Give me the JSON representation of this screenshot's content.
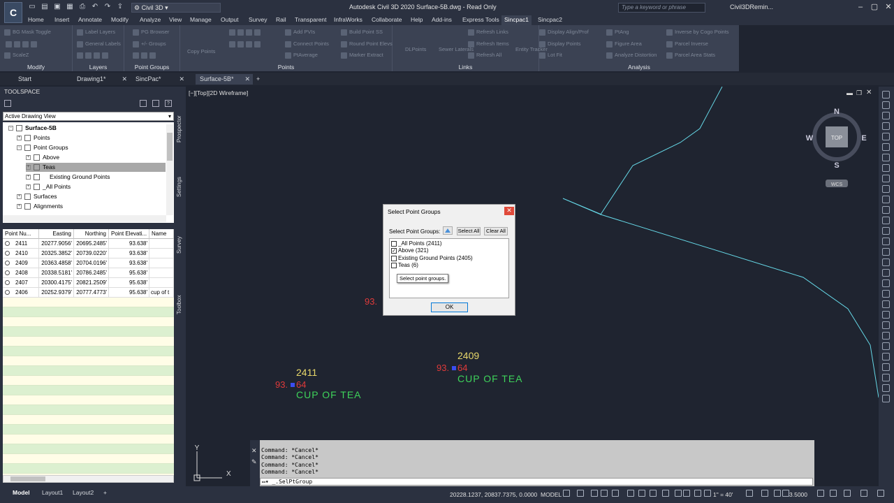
{
  "window": {
    "logo": "C",
    "workspace": "Civil 3D",
    "title": "Autodesk Civil 3D 2020   Surface-5B.dwg - Read Only",
    "search_placeholder": "Type a keyword or phrase",
    "user": "Civil3DRemin..."
  },
  "ribbon_tabs": [
    "Home",
    "Insert",
    "Annotate",
    "Modify",
    "Analyze",
    "View",
    "Manage",
    "Output",
    "Survey",
    "Rail",
    "Transparent",
    "InfraWorks",
    "Collaborate",
    "Help",
    "Add-ins",
    "Express Tools",
    "Sincpac1",
    "Sincpac2"
  ],
  "ribbon_active": "Sincpac1",
  "ribbon": {
    "panels": [
      {
        "title": "Modify",
        "items": [
          "BG Mask Toggle",
          "Label Layers",
          "General Labels",
          "ScaleZ"
        ]
      },
      {
        "title": "Layers",
        "items": []
      },
      {
        "title": "Point Groups",
        "items": [
          "PG Browser",
          "+/- Groups"
        ]
      },
      {
        "title": "Points",
        "items": [
          "Copy Points",
          "Add PVIs",
          "Connect Points",
          "PtAverage",
          "Build Point SS",
          "Round Point Elevs",
          "Marker Extract"
        ]
      },
      {
        "title": "Links",
        "items": [
          "DLPoints",
          "Sewer Laterals",
          "Refresh Links",
          "Refresh Items",
          "Refresh All",
          "Entity Tracker"
        ]
      },
      {
        "title": "Analysis",
        "items": [
          "Display Align/Prof",
          "Display Points",
          "Lot Fit",
          "PtAng",
          "Figure Area",
          "Analyze Distortion",
          "Inverse by Cogo Points",
          "Parcel Inverse",
          "Parcel Area Stats"
        ]
      }
    ]
  },
  "doc_tabs": [
    {
      "label": "Start",
      "closable": false
    },
    {
      "label": "Drawing1*",
      "closable": true
    },
    {
      "label": "SincPac*",
      "closable": true
    },
    {
      "label": "Surface-5B*",
      "closable": true,
      "active": true
    }
  ],
  "toolspace": {
    "title": "TOOLSPACE",
    "view": "Active Drawing View",
    "side_tabs": [
      "Prospector",
      "Settings",
      "Survey",
      "Toolbox"
    ],
    "tree": [
      {
        "label": "Surface-5B",
        "level": 0,
        "bold": true
      },
      {
        "label": "Points",
        "level": 1
      },
      {
        "label": "Point Groups",
        "level": 1
      },
      {
        "label": "Above",
        "level": 2
      },
      {
        "label": "Teas",
        "level": 2,
        "selected": true
      },
      {
        "label": "Existing Ground Points",
        "level": 2
      },
      {
        "label": "_All Points",
        "level": 2
      },
      {
        "label": "Surfaces",
        "level": 1
      },
      {
        "label": "Alignments",
        "level": 1
      }
    ],
    "grid": {
      "columns": [
        "Point Nu...",
        "Easting",
        "Northing",
        "Point Elevati...",
        "Name"
      ],
      "rows": [
        [
          "2411",
          "20277.9056'",
          "20695.2485'",
          "93.638'",
          ""
        ],
        [
          "2410",
          "20325.3852'",
          "20739.0220'",
          "93.638'",
          ""
        ],
        [
          "2409",
          "20363.4858'",
          "20704.0196'",
          "93.638'",
          ""
        ],
        [
          "2408",
          "20338.5181'",
          "20786.2485'",
          "95.638'",
          ""
        ],
        [
          "2407",
          "20300.4175'",
          "20821.2509'",
          "95.638'",
          ""
        ],
        [
          "2406",
          "20252.9379'",
          "20777.4773'",
          "95.638'",
          "cup of t"
        ]
      ]
    }
  },
  "viewport": {
    "label": "[−][Top][2D Wireframe]",
    "compass": {
      "n": "N",
      "s": "S",
      "e": "E",
      "w": "W",
      "top": "TOP",
      "ucs": "WCS"
    },
    "points": [
      {
        "number": "2411",
        "elev_a": "93.",
        "elev_b": "64",
        "desc": "CUP OF TEA"
      },
      {
        "number": "2409",
        "elev_a": "93.",
        "elev_b": "64",
        "desc": "CUP OF TEA"
      },
      {
        "number": "",
        "elev_a": "93.",
        "elev_b": "",
        "desc": ""
      }
    ],
    "axis_x": "X",
    "axis_y": "Y"
  },
  "dialog": {
    "title": "Select Point Groups",
    "label": "Select Point Groups:",
    "select_all": "Select All",
    "clear_all": "Clear All",
    "groups": [
      {
        "label": "_All Points (2411)",
        "checked": false
      },
      {
        "label": "Above (321)",
        "checked": true
      },
      {
        "label": "Existing Ground Points (2405)",
        "checked": false
      },
      {
        "label": "Teas (6)",
        "checked": false
      }
    ],
    "tooltip": "Select point groups.",
    "ok": "OK"
  },
  "command_line": {
    "history": [
      "Command: *Cancel*",
      "Command: *Cancel*",
      "Command: *Cancel*",
      "Command: *Cancel*"
    ],
    "input": "_.SelPtGroup"
  },
  "status": {
    "layout_tabs": [
      "Model",
      "Layout1",
      "Layout2"
    ],
    "coords": "20228.1237, 20837.7375, 0.0000",
    "model": "MODEL",
    "scale": "1\" = 40'",
    "annoscale": "3.5000"
  },
  "colors": {
    "cyan_line": "#66d9e8",
    "point_number": "#e8d86a",
    "point_elev": "#e03a3a",
    "point_desc": "#3ed35a",
    "marker": "#3a4df0"
  }
}
